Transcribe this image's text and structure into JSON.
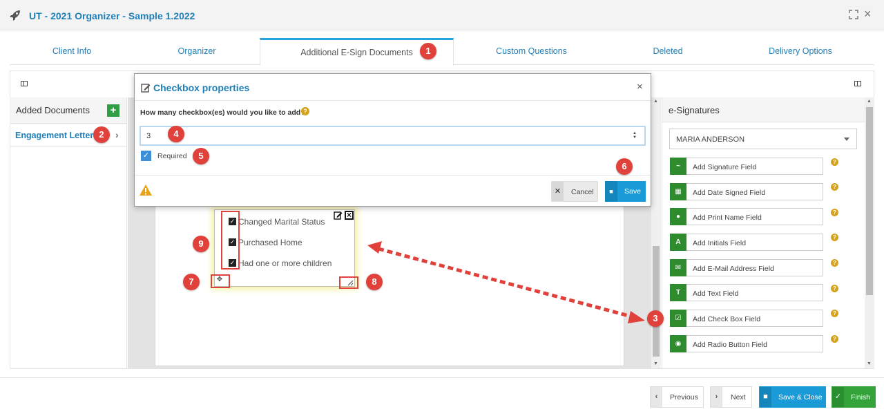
{
  "window": {
    "title": "UT - 2021 Organizer - Sample 1.2022"
  },
  "tabs": [
    {
      "label": "Client Info"
    },
    {
      "label": "Organizer"
    },
    {
      "label": "Additional E-Sign Documents"
    },
    {
      "label": "Custom Questions"
    },
    {
      "label": "Deleted"
    },
    {
      "label": "Delivery Options"
    }
  ],
  "active_tab": "Additional E-Sign Documents",
  "left_panel": {
    "title": "Added Documents",
    "add_label": "+",
    "items": [
      {
        "label": "Engagement Letter"
      }
    ]
  },
  "document": {
    "checkbox_field": {
      "options": [
        {
          "label": "Changed Marital Status",
          "checked": true
        },
        {
          "label": "Purchased Home",
          "checked": true
        },
        {
          "label": "Had one or more children",
          "checked": true
        }
      ]
    }
  },
  "right_panel": {
    "title": "e-Signatures",
    "signer": "MARIA ANDERSON",
    "fields": [
      {
        "label": "Add Signature Field",
        "icon": "signature-icon"
      },
      {
        "label": "Add Date Signed Field",
        "icon": "calendar-icon"
      },
      {
        "label": "Add Print Name Field",
        "icon": "user-icon"
      },
      {
        "label": "Add Initials Field",
        "icon": "initials-icon"
      },
      {
        "label": "Add E-Mail Address Field",
        "icon": "envelope-icon"
      },
      {
        "label": "Add Text Field",
        "icon": "text-icon"
      },
      {
        "label": "Add Check Box Field",
        "icon": "checkbox-icon"
      },
      {
        "label": "Add Radio Button Field",
        "icon": "radio-icon"
      }
    ]
  },
  "modal": {
    "title": "Checkbox properties",
    "question": "How many checkbox(es) would you like to add?",
    "count_value": "3",
    "required_label": "Required",
    "required_checked": true,
    "cancel_label": "Cancel",
    "save_label": "Save"
  },
  "footer": {
    "previous_label": "Previous",
    "next_label": "Next",
    "save_close_label": "Save & Close",
    "finish_label": "Finish"
  },
  "annotations": [
    "1",
    "2",
    "3",
    "4",
    "5",
    "6",
    "7",
    "8",
    "9"
  ],
  "colors": {
    "brand_blue": "#1f7fb7",
    "accent_blue": "#1a9bd7",
    "green": "#2e8b2e",
    "finish_green": "#34a43a",
    "annotation_red": "#e0413a",
    "help_gold": "#d4a21b"
  }
}
